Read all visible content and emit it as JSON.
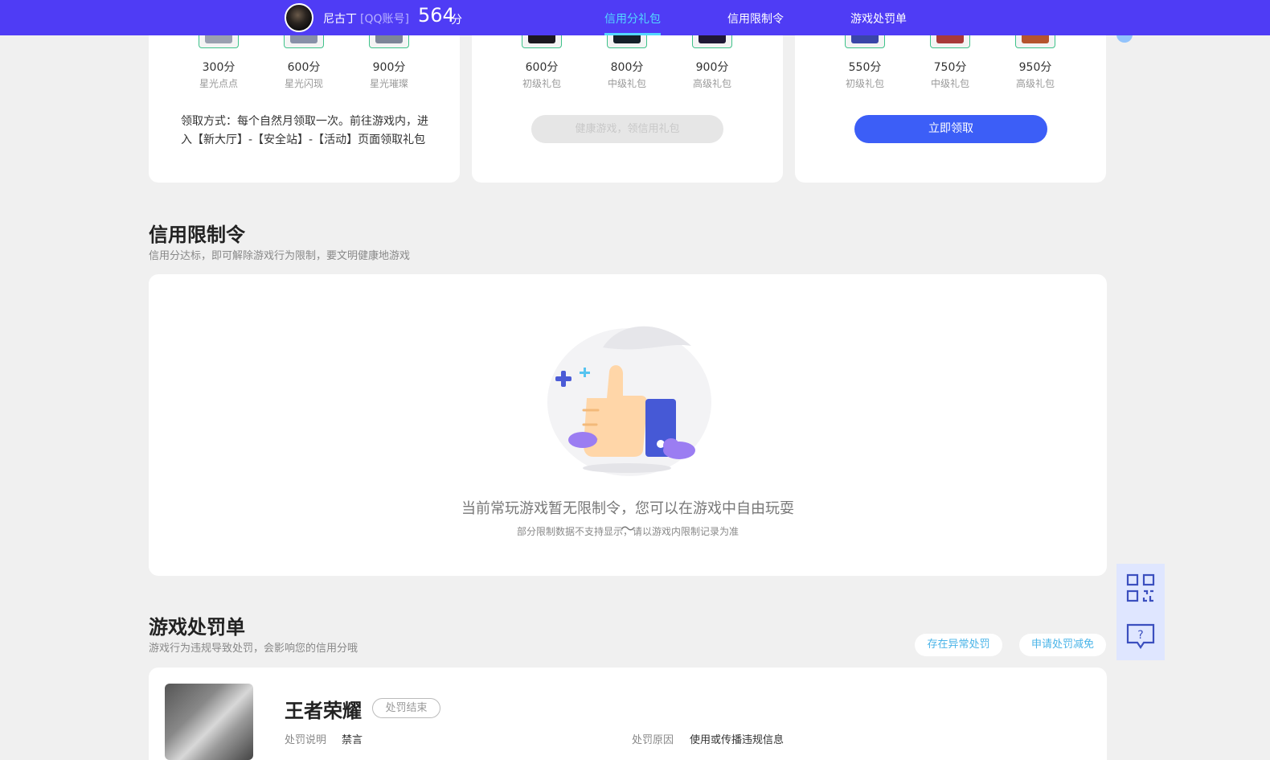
{
  "header": {
    "nickname": "尼古丁",
    "account_type": "[QQ账号]",
    "score": "564",
    "score_unit": "分",
    "nav": [
      "信用分礼包",
      "信用限制令",
      "游戏处罚单"
    ],
    "accent": "#4f3cf5"
  },
  "gift_cards": [
    {
      "tiers": [
        {
          "score": "300分",
          "name": "星光点点"
        },
        {
          "score": "600分",
          "name": "星光闪现"
        },
        {
          "score": "900分",
          "name": "星光璀璨"
        }
      ],
      "desc": "领取方式：每个自然月领取一次。前往游戏内，进入【新大厅】-【安全站】-【活动】页面领取礼包"
    },
    {
      "tiers": [
        {
          "score": "600分",
          "name": "初级礼包"
        },
        {
          "score": "800分",
          "name": "中级礼包"
        },
        {
          "score": "900分",
          "name": "高级礼包"
        }
      ],
      "button": "健康游戏，领信用礼包"
    },
    {
      "tiers": [
        {
          "score": "550分",
          "name": "初级礼包"
        },
        {
          "score": "750分",
          "name": "中级礼包"
        },
        {
          "score": "950分",
          "name": "高级礼包"
        }
      ],
      "button": "立即领取"
    }
  ],
  "restrictions": {
    "title": "信用限制令",
    "subtitle": "信用分达标，即可解除游戏行为限制，要文明健康地游戏",
    "empty_main": "当前常玩游戏暂无限制令，您可以在游戏中自由玩耍～",
    "empty_sub": "部分限制数据不支持显示，请以游戏内限制记录为准"
  },
  "penalties": {
    "title": "游戏处罚单",
    "subtitle": "游戏行为违规导致处罚，会影响您的信用分哦",
    "abnormal_btn": "存在异常处罚",
    "appeal_btn": "申请处罚减免",
    "record": {
      "game": "王者荣耀",
      "status": "处罚结束",
      "desc_label": "处罚说明",
      "desc_value": "禁言",
      "reason_label": "处罚原因",
      "reason_value": "使用或传播违规信息"
    }
  },
  "side_tools": {
    "qr_icon": "qr-code-icon",
    "help_icon": "help-chat-icon"
  }
}
